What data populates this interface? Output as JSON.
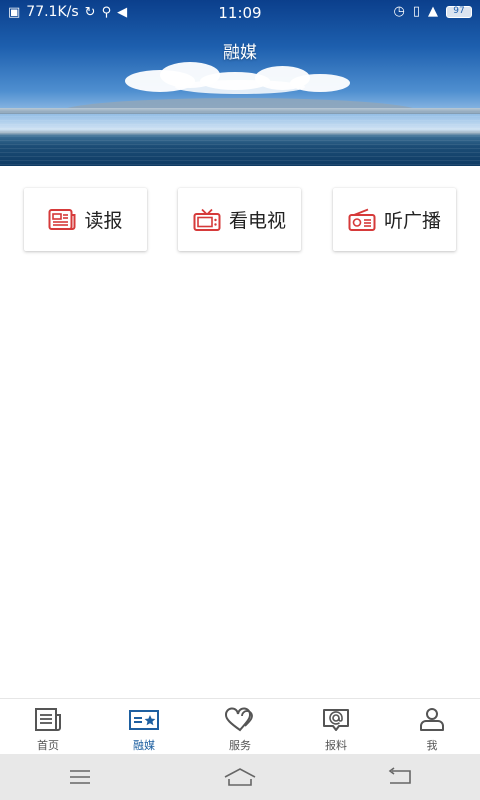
{
  "status_bar": {
    "network_speed": "77.1K/s",
    "time": "11:09",
    "battery": "97"
  },
  "header": {
    "title": "融媒"
  },
  "cards": [
    {
      "label": "读报",
      "icon": "newspaper-icon"
    },
    {
      "label": "看电视",
      "icon": "tv-icon"
    },
    {
      "label": "听广播",
      "icon": "radio-icon"
    }
  ],
  "bottom_nav": [
    {
      "label": "首页",
      "icon": "home-news-icon",
      "active": false
    },
    {
      "label": "融媒",
      "icon": "media-card-icon",
      "active": true
    },
    {
      "label": "服务",
      "icon": "heart-service-icon",
      "active": false
    },
    {
      "label": "报料",
      "icon": "report-at-icon",
      "active": false
    },
    {
      "label": "我",
      "icon": "person-icon",
      "active": false
    }
  ],
  "system_nav": [
    "menu-icon",
    "home-icon",
    "back-icon"
  ],
  "colors": {
    "accent": "#1d5fa0",
    "card_icon": "#d63a3a",
    "nav_icon": "#555555"
  }
}
